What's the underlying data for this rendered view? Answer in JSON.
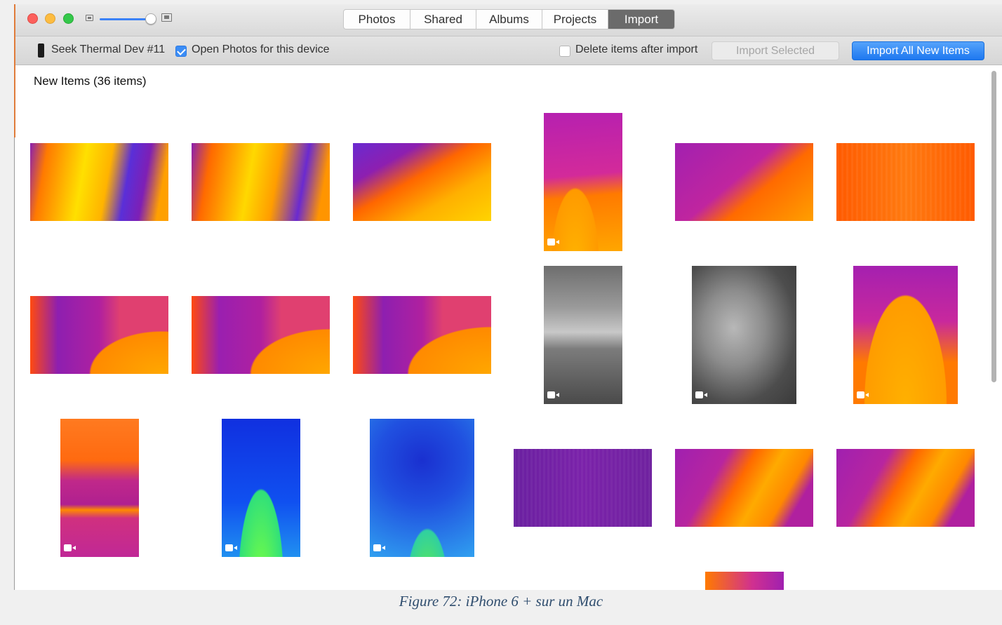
{
  "window": {
    "tabs": [
      {
        "label": "Photos",
        "active": false
      },
      {
        "label": "Shared",
        "active": false
      },
      {
        "label": "Albums",
        "active": false
      },
      {
        "label": "Projects",
        "active": false
      },
      {
        "label": "Import",
        "active": true
      }
    ],
    "zoom_slider_level": 1.0
  },
  "toolbar": {
    "device_icon": "iphone-icon",
    "device_name": "Seek Thermal Dev #11",
    "open_photos_checked": true,
    "open_photos_label": "Open Photos for this device",
    "delete_checked": false,
    "delete_label": "Delete items after import",
    "import_selected_label": "Import Selected",
    "import_all_label": "Import All New Items"
  },
  "content": {
    "section_title": "New Items (36 items)"
  },
  "thumbnails": [
    {
      "type": "photo",
      "palette": "thermal-iron"
    },
    {
      "type": "photo",
      "palette": "thermal-iron"
    },
    {
      "type": "photo",
      "palette": "thermal-iron"
    },
    {
      "type": "video",
      "palette": "thermal-iron"
    },
    {
      "type": "photo",
      "palette": "thermal-iron"
    },
    {
      "type": "photo",
      "palette": "thermal-iron"
    },
    {
      "type": "photo",
      "palette": "thermal-iron"
    },
    {
      "type": "photo",
      "palette": "thermal-iron"
    },
    {
      "type": "photo",
      "palette": "thermal-iron"
    },
    {
      "type": "video",
      "palette": "grayscale"
    },
    {
      "type": "video",
      "palette": "grayscale"
    },
    {
      "type": "video",
      "palette": "thermal-iron"
    },
    {
      "type": "video",
      "palette": "thermal-iron"
    },
    {
      "type": "video",
      "palette": "thermal-blue-green"
    },
    {
      "type": "video",
      "palette": "thermal-blue-green"
    },
    {
      "type": "photo",
      "palette": "thermal-iron"
    },
    {
      "type": "photo",
      "palette": "thermal-iron"
    },
    {
      "type": "photo",
      "palette": "thermal-iron"
    },
    {
      "type": "photo",
      "palette": "thermal-iron"
    }
  ],
  "caption": "Figure 72: iPhone 6 + sur un Mac",
  "colors": {
    "accent_blue": "#1e78f0",
    "active_tab": "#6b6b6b",
    "caption_text": "#2f4d6e"
  }
}
